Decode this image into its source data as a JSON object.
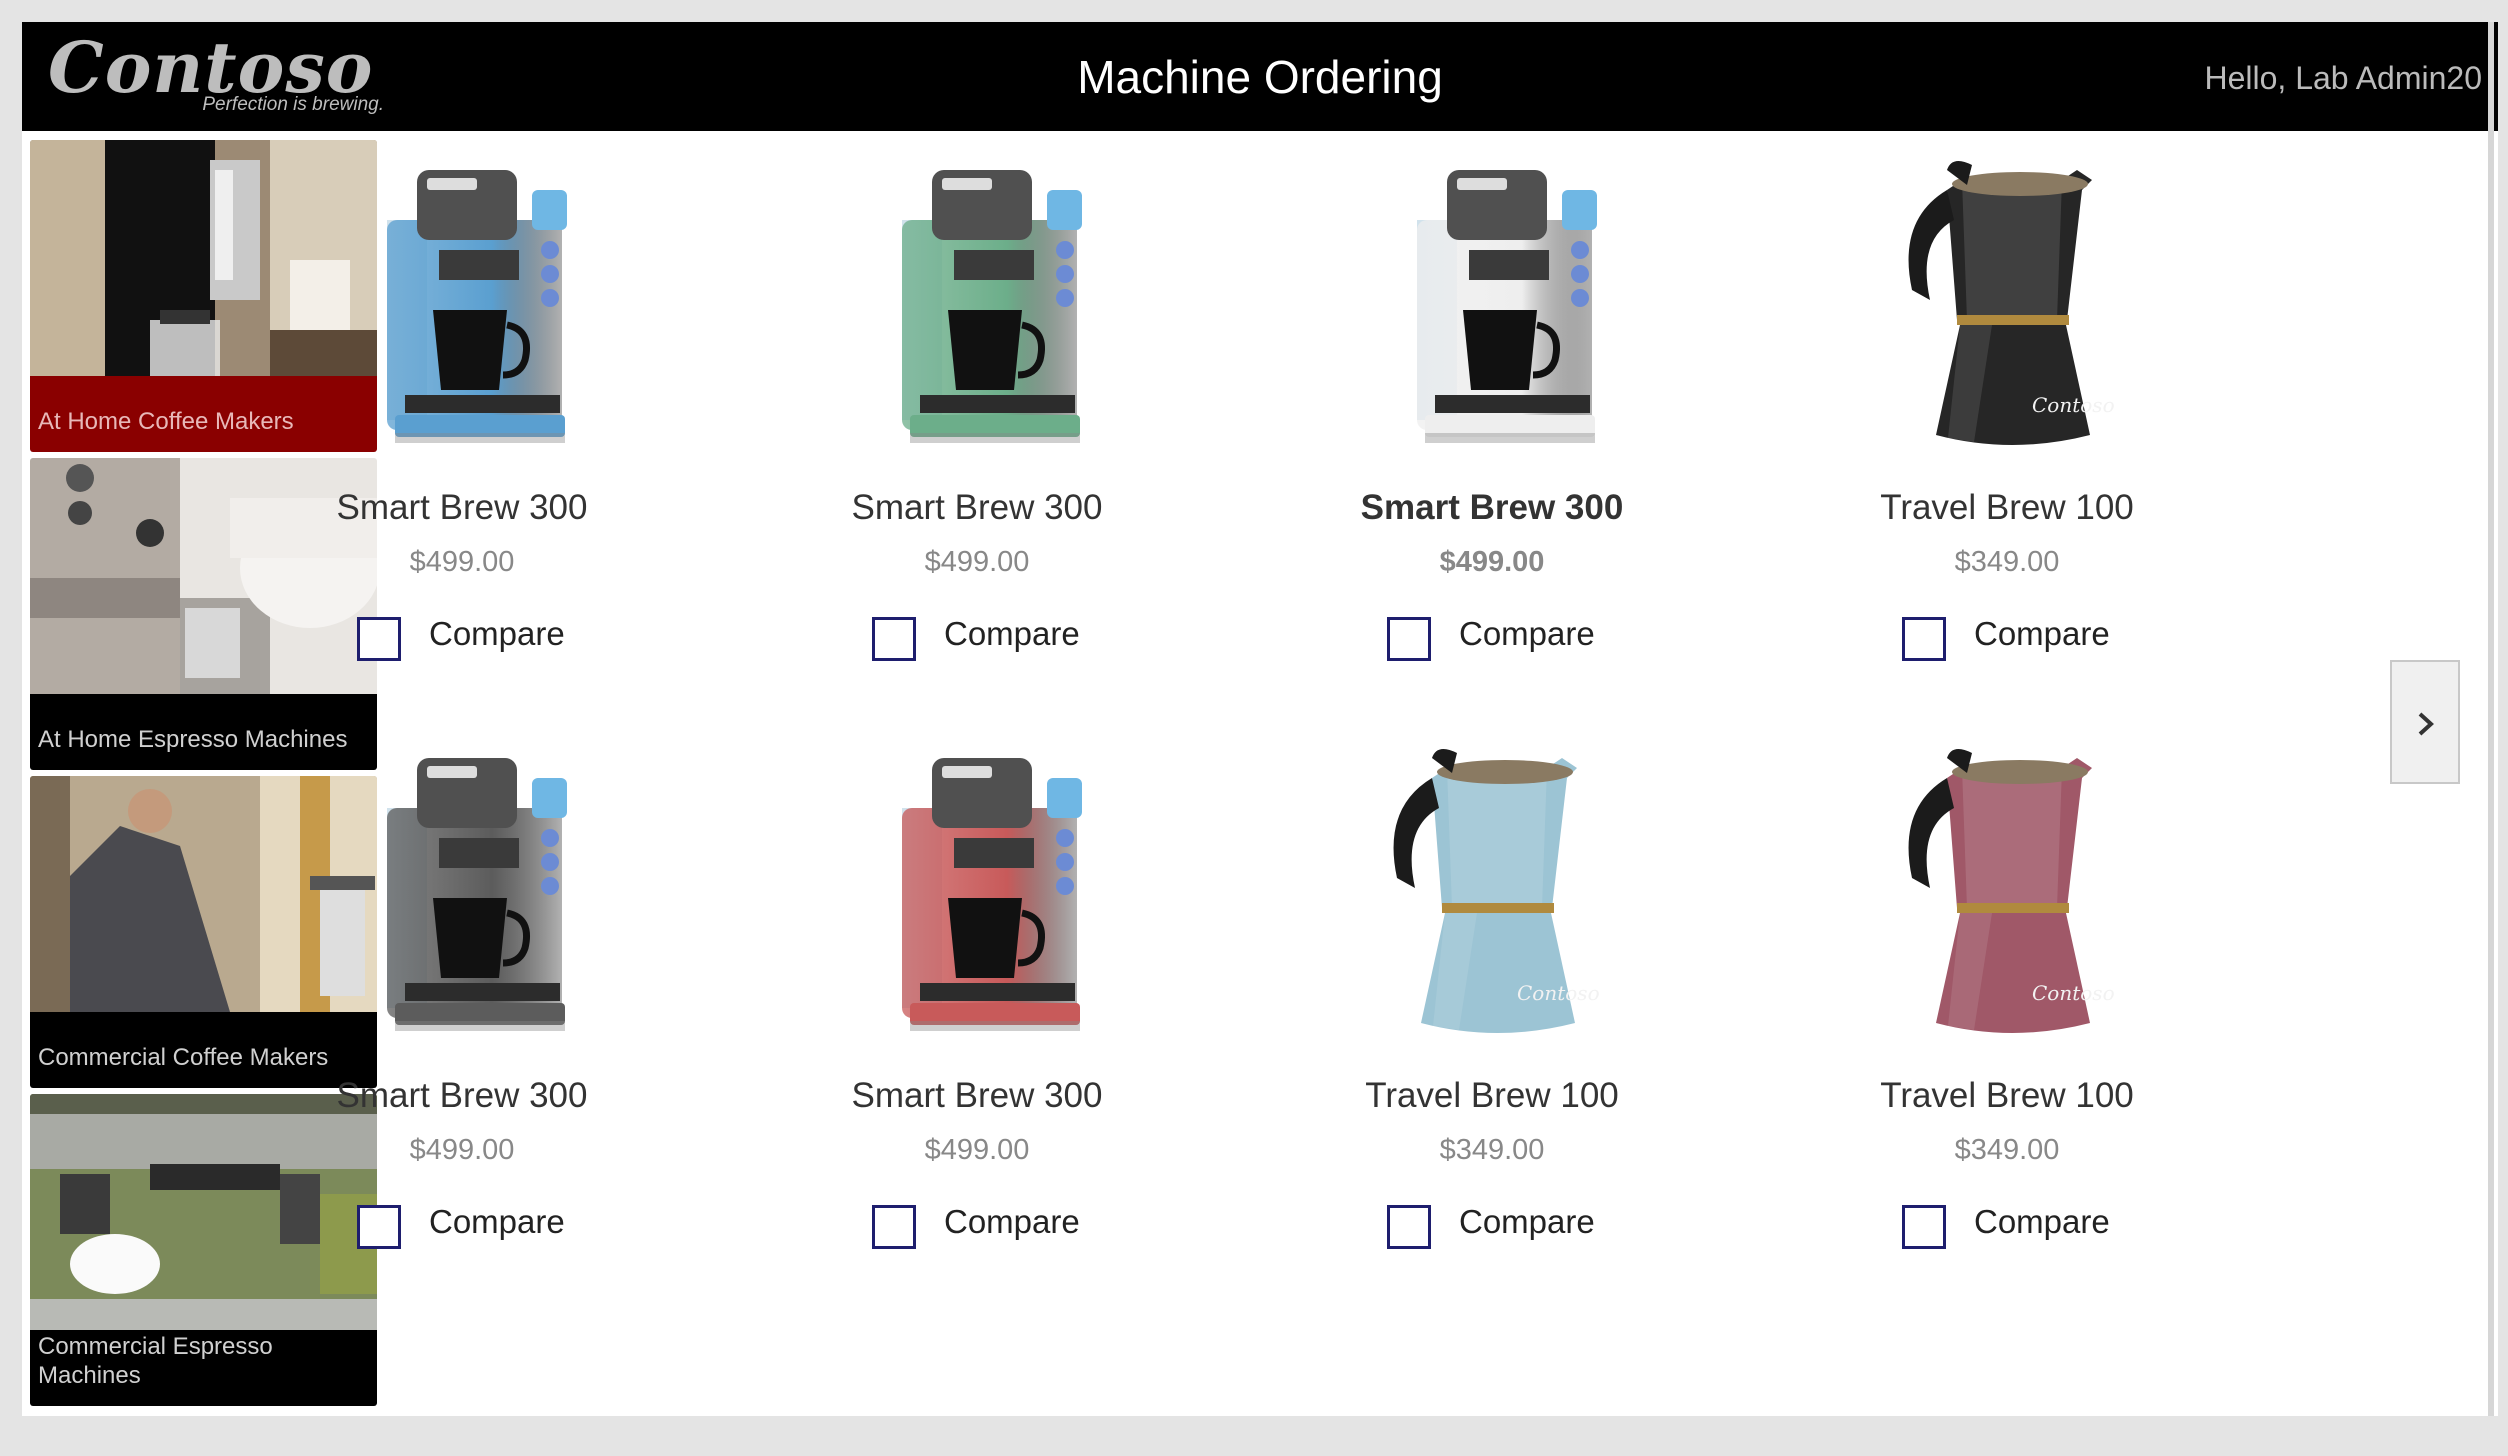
{
  "header": {
    "logo_text": "Contoso",
    "logo_tagline": "Perfection is brewing.",
    "title": "Machine Ordering",
    "greeting": "Hello, Lab Admin20"
  },
  "categories": [
    {
      "label": "At Home Coffee Makers",
      "active": true
    },
    {
      "label": "At Home Espresso Machines",
      "active": false
    },
    {
      "label": "Commercial Coffee Makers",
      "active": false
    },
    {
      "label": "Commercial Espresso Machines",
      "active": false
    }
  ],
  "products": [
    {
      "name": "Smart Brew 300",
      "price": "$499.00",
      "color": "#5a9fd0",
      "kind": "brewer",
      "compare": "Compare"
    },
    {
      "name": "Smart Brew 300",
      "price": "$499.00",
      "color": "#6cae8a",
      "kind": "brewer",
      "compare": "Compare"
    },
    {
      "name": "Smart Brew 300",
      "price": "$499.00",
      "color": "#eeeeee",
      "kind": "brewer",
      "compare": "Compare",
      "selected": true
    },
    {
      "name": "Travel Brew 100",
      "price": "$349.00",
      "color": "#262626",
      "kind": "moka",
      "compare": "Compare"
    },
    {
      "name": "Smart Brew 300",
      "price": "$499.00",
      "color": "#5c5c5c",
      "kind": "brewer",
      "compare": "Compare"
    },
    {
      "name": "Smart Brew 300",
      "price": "$499.00",
      "color": "#c85a5a",
      "kind": "brewer",
      "compare": "Compare"
    },
    {
      "name": "Travel Brew 100",
      "price": "$349.00",
      "color": "#9cc4d4",
      "kind": "moka",
      "compare": "Compare"
    },
    {
      "name": "Travel Brew 100",
      "price": "$349.00",
      "color": "#a05868",
      "kind": "moka",
      "compare": "Compare"
    }
  ],
  "icons": {
    "next": "chevron-right-icon"
  }
}
